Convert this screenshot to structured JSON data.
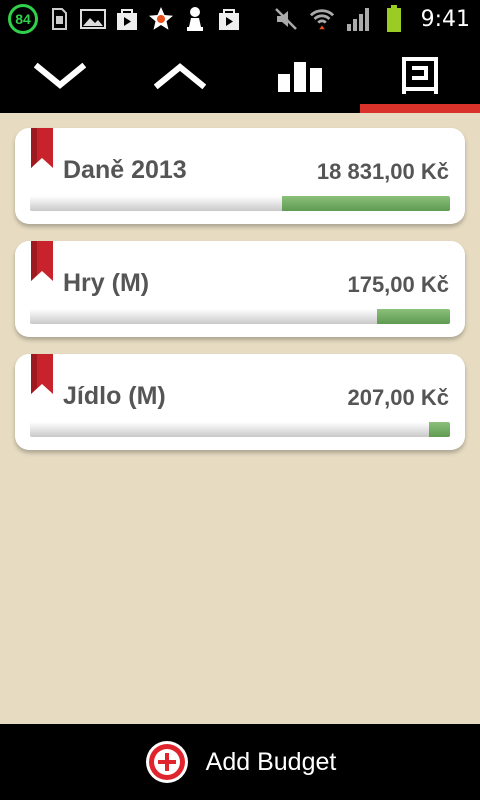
{
  "status_bar": {
    "time": "9:41",
    "notification_badge": "84",
    "icons": [
      "sd-card-icon",
      "image-icon",
      "play-store-icon",
      "star-icon",
      "chess-pawn-icon",
      "play-store-icon",
      "mute-icon",
      "wifi-icon",
      "signal-icon",
      "battery-icon"
    ]
  },
  "toolbar": {
    "buttons": [
      "collapse-all",
      "expand-all",
      "statistics",
      "budget-view"
    ],
    "active": "budget-view",
    "accent_color": "#d9322b"
  },
  "budgets": [
    {
      "name": "Daně 2013",
      "amount": "18 831,00 Kč",
      "progress": 0.4
    },
    {
      "name": "Hry (M)",
      "amount": "175,00 Kč",
      "progress": 0.175
    },
    {
      "name": "Jídlo (M)",
      "amount": "207,00 Kč",
      "progress": 0.05
    }
  ],
  "bottom_bar": {
    "add_label": "Add Budget"
  },
  "colors": {
    "background": "#e7dcc2",
    "progress_fill": "#6fa862",
    "bookmark": "#c8232c"
  }
}
